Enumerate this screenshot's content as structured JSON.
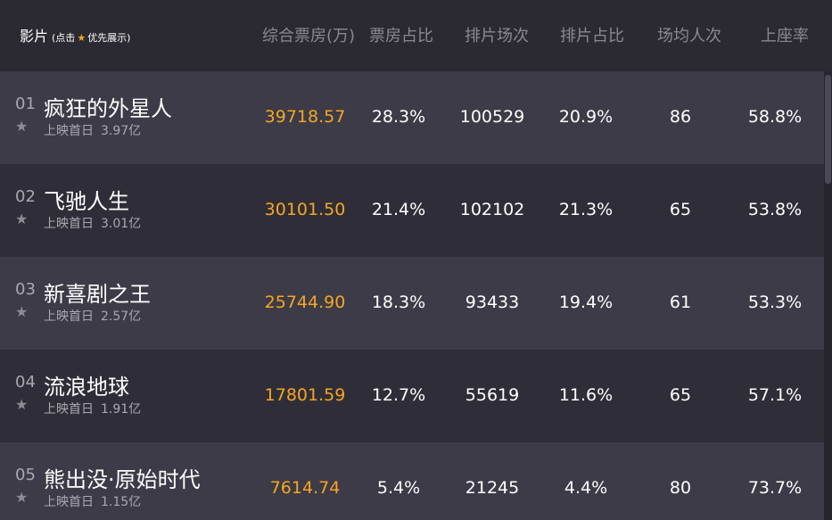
{
  "header": {
    "title": "影片",
    "hint_open": "(点击",
    "hint_close": "优先展示)",
    "columns": [
      "综合票房(万)",
      "票房占比",
      "排片场次",
      "排片占比",
      "场均人次",
      "上座率"
    ]
  },
  "colors": {
    "accent": "#f5a623",
    "row_odd": "#3c3b47",
    "row_even": "#2f2e38",
    "header_text": "#8a8893"
  },
  "icons": {
    "favorite": "star-icon"
  },
  "rows": [
    {
      "rank": "01",
      "name": "疯狂的外星人",
      "sub_label": "上映首日",
      "sub_value": "3.97亿",
      "box": "39718.57",
      "box_share": "28.3%",
      "shows": "100529",
      "show_share": "20.9%",
      "avg_people": "86",
      "occupancy": "58.8%"
    },
    {
      "rank": "02",
      "name": "飞驰人生",
      "sub_label": "上映首日",
      "sub_value": "3.01亿",
      "box": "30101.50",
      "box_share": "21.4%",
      "shows": "102102",
      "show_share": "21.3%",
      "avg_people": "65",
      "occupancy": "53.8%"
    },
    {
      "rank": "03",
      "name": "新喜剧之王",
      "sub_label": "上映首日",
      "sub_value": "2.57亿",
      "box": "25744.90",
      "box_share": "18.3%",
      "shows": "93433",
      "show_share": "19.4%",
      "avg_people": "61",
      "occupancy": "53.3%"
    },
    {
      "rank": "04",
      "name": "流浪地球",
      "sub_label": "上映首日",
      "sub_value": "1.91亿",
      "box": "17801.59",
      "box_share": "12.7%",
      "shows": "55619",
      "show_share": "11.6%",
      "avg_people": "65",
      "occupancy": "57.1%"
    },
    {
      "rank": "05",
      "name": "熊出没·原始时代",
      "sub_label": "上映首日",
      "sub_value": "1.15亿",
      "box": "7614.74",
      "box_share": "5.4%",
      "shows": "21245",
      "show_share": "4.4%",
      "avg_people": "80",
      "occupancy": "73.7%"
    }
  ]
}
